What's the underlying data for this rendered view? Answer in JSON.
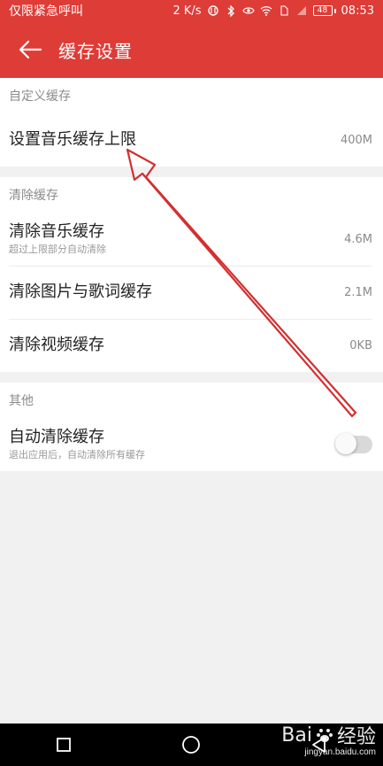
{
  "status_bar": {
    "carrier_text": "仅限紧急呼叫",
    "speed": "2 K/s",
    "battery": "48",
    "time": "08:53"
  },
  "app_bar": {
    "title": "缓存设置"
  },
  "sections": [
    {
      "header": "自定义缓存",
      "rows": [
        {
          "title": "设置音乐缓存上限",
          "value": "400M"
        }
      ]
    },
    {
      "header": "清除缓存",
      "rows": [
        {
          "title": "清除音乐缓存",
          "subtitle": "超过上限部分自动清除",
          "value": "4.6M"
        },
        {
          "title": "清除图片与歌词缓存",
          "value": "2.1M"
        },
        {
          "title": "清除视频缓存",
          "value": "0KB"
        }
      ]
    },
    {
      "header": "其他",
      "rows": [
        {
          "title": "自动清除缓存",
          "subtitle": "退出应用后，自动清除所有缓存",
          "toggle": false
        }
      ]
    }
  ],
  "nav_bar": {
    "items": [
      "recent-square",
      "home-circle",
      "back-triangle"
    ]
  },
  "watermark": {
    "brand": "Bai",
    "brand_cn": "经验",
    "url": "jingyan.baidu.com"
  },
  "colors": {
    "accent": "#de3c37",
    "background": "#f1f1f1",
    "annotation_arrow": "#d32f2f"
  }
}
